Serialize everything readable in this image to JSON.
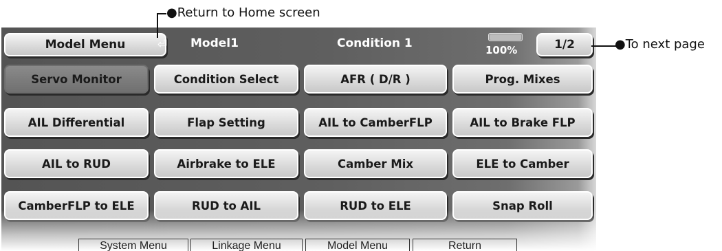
{
  "annotations": {
    "return_home": "●Return to Home screen",
    "next_page": "●To next page"
  },
  "header": {
    "model_menu_label": "Model Menu",
    "home_icon": "return-home-icon",
    "model_name": "Model1",
    "condition": "Condition 1",
    "battery_percent_text": "100%",
    "battery_level": 1.0,
    "page_label": "1/2"
  },
  "menu_items": [
    "Servo Monitor",
    "Condition Select",
    "AFR ( D/R )",
    "Prog. Mixes",
    "AIL Differential",
    "Flap Setting",
    "AIL to CamberFLP",
    "AIL to Brake FLP",
    "AIL to RUD",
    "Airbrake to ELE",
    "Camber Mix",
    "ELE to Camber",
    "CamberFLP to ELE",
    "RUD to AIL",
    "RUD to ELE",
    "Snap Roll"
  ],
  "selected_index": 0,
  "footer": [
    "System Menu",
    "Linkage Menu",
    "Model Menu",
    "Return"
  ]
}
